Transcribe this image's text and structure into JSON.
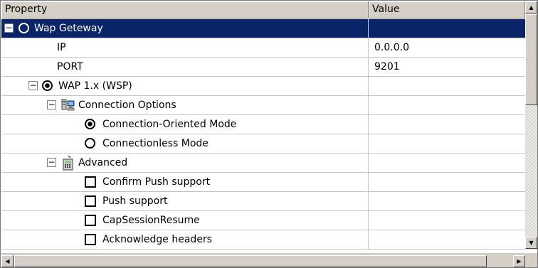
{
  "header": {
    "property": "Property",
    "value": "Value"
  },
  "rows": [
    {
      "label": "Wap Geteway",
      "value": ""
    },
    {
      "label": "IP",
      "value": "0.0.0.0"
    },
    {
      "label": "PORT",
      "value": "9201"
    },
    {
      "label": "WAP 1.x (WSP)",
      "value": ""
    },
    {
      "label": "Connection Options",
      "value": ""
    },
    {
      "label": "Connection-Oriented Mode",
      "value": ""
    },
    {
      "label": "Connectionless Mode",
      "value": ""
    },
    {
      "label": "Advanced",
      "value": ""
    },
    {
      "label": "Confirm Push support",
      "value": ""
    },
    {
      "label": "Push support",
      "value": ""
    },
    {
      "label": "CapSessionResume",
      "value": ""
    },
    {
      "label": "Acknowledge headers",
      "value": ""
    }
  ],
  "icons": {
    "expand": "minus-box",
    "radio_selected": "radio-selected",
    "radio_unselected": "radio-unselected",
    "checkbox": "checkbox-unchecked",
    "connection": "network-computers",
    "advanced": "device-settings"
  },
  "expanders": {
    "minus": "−"
  },
  "scroll": {
    "up": "▲",
    "down": "▼",
    "left": "◀",
    "right": "▶"
  },
  "colors": {
    "selection": "#0a246a",
    "chrome": "#d4d0c8"
  }
}
